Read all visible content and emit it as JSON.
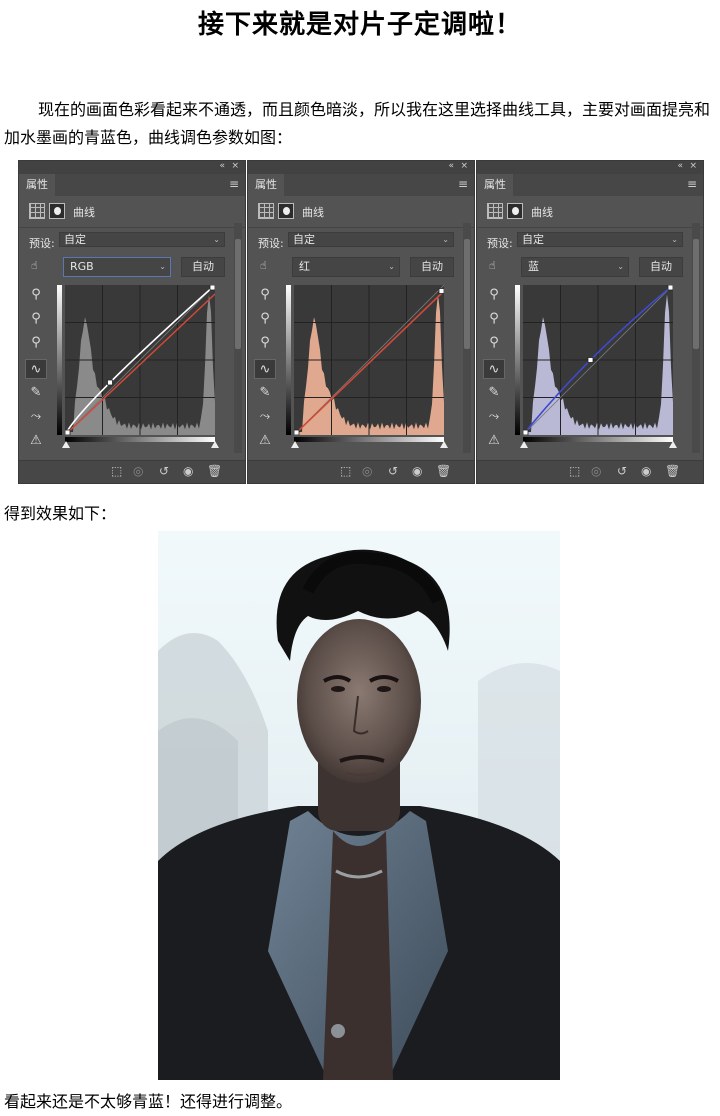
{
  "document": {
    "title": "接下来就是对片子定调啦！",
    "intro": "现在的画面色彩看起来不通透，而且颜色暗淡，所以我在这里选择曲线工具，主要对画面提亮和加水墨画的青蓝色，曲线调色参数如图：",
    "result_caption": "得到效果如下：",
    "conclusion": "看起来还是不太够青蓝！还得进行调整。"
  },
  "panel_common": {
    "tab_label": "属性",
    "layer_label": "曲线",
    "preset_label": "预设:",
    "preset_value": "自定",
    "auto_label": "自动",
    "collapse_label": "«",
    "close_label": "×"
  },
  "panels": [
    {
      "channel": "RGB",
      "histogram_color": "#8a8a8a",
      "curve_color": "#ffffff",
      "ref_color": "#d04a38",
      "selected": true,
      "curve": [
        [
          0,
          0
        ],
        [
          0.3,
          0.35
        ],
        [
          1,
          1
        ]
      ],
      "ref_curve": [
        [
          0,
          0
        ],
        [
          1,
          0.94
        ]
      ]
    },
    {
      "channel": "红",
      "histogram_color": "#e0a98f",
      "curve_color": "#d04a38",
      "ref_color": "",
      "selected": false,
      "curve": [
        [
          0,
          0
        ],
        [
          1,
          0.96
        ]
      ],
      "ref_curve": []
    },
    {
      "channel": "蓝",
      "histogram_color": "#b9b9d6",
      "curve_color": "#3d4ad0",
      "ref_color": "",
      "selected": false,
      "curve": [
        [
          0,
          0
        ],
        [
          0.45,
          0.5
        ],
        [
          1,
          1
        ]
      ],
      "ref_curve": []
    }
  ],
  "photo": {
    "alt_description_none": "",
    "bg_top": "#eef7f9",
    "bg_bottom": "#c9d3d8"
  }
}
